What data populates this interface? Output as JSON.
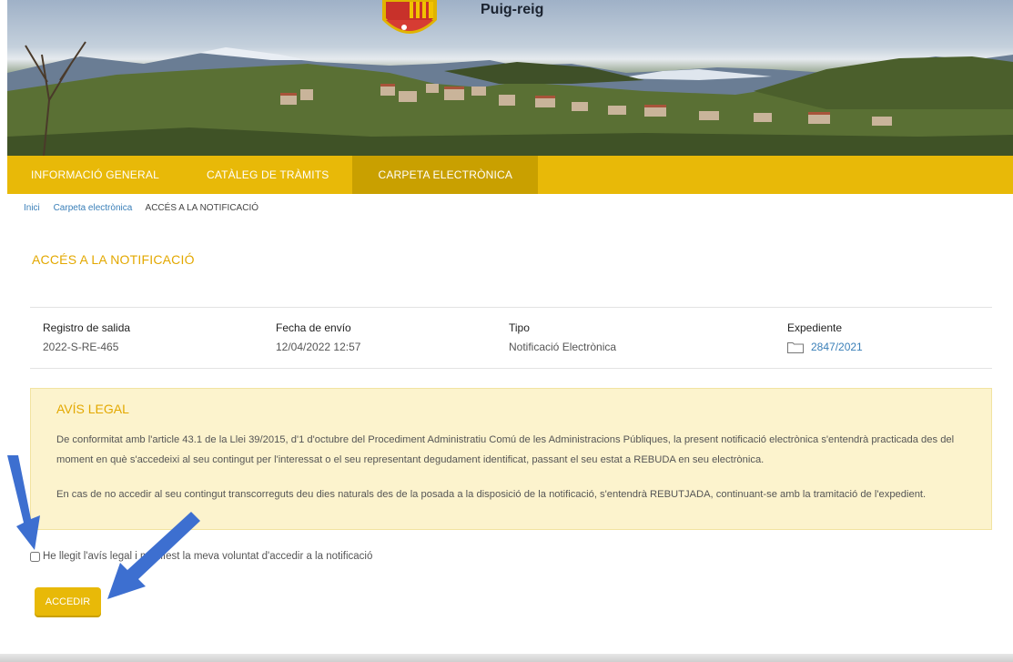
{
  "header": {
    "town_name": "Puig-reig"
  },
  "nav": {
    "items": [
      {
        "label": "INFORMACIÓ GENERAL"
      },
      {
        "label": "CATÀLEG DE TRÀMITS"
      },
      {
        "label": "CARPETA ELECTRÒNICA"
      }
    ],
    "active_index": 2
  },
  "breadcrumb": {
    "items": [
      "Inici",
      "Carpeta electrònica",
      "ACCÉS A LA NOTIFICACIÓ"
    ]
  },
  "page": {
    "title": "ACCÉS A LA NOTIFICACIÓ"
  },
  "details": {
    "registro": {
      "label": "Registro de salida",
      "value": "2022-S-RE-465"
    },
    "fecha": {
      "label": "Fecha de envío",
      "value": "12/04/2022 12:57"
    },
    "tipo": {
      "label": "Tipo",
      "value": "Notificació Electrònica"
    },
    "expediente": {
      "label": "Expediente",
      "value": "2847/2021",
      "icon": "folder-icon"
    }
  },
  "legal": {
    "title": "AVÍS LEGAL",
    "paragraph1": "De conformitat amb l'article 43.1 de la Llei 39/2015, d'1 d'octubre del Procediment Administratiu Comú de les Administracions Públiques, la present notificació electrònica s'entendrà practicada des del moment en què s'accedeixi al seu contingut per l'interessat o el seu representant degudament identificat, passant el seu estat a REBUDA en seu electrònica.",
    "paragraph2": "En cas de no accedir al seu contingut transcorreguts deu dies naturals des de la posada a la disposició de la notificació, s'entendrà REBUTJADA, continuant-se amb la tramitació de l'expedient."
  },
  "consent": {
    "label": "He llegit l'avís legal i manifest la meva voluntat d'accedir a la notificació",
    "checked": false
  },
  "actions": {
    "access_label": "ACCEDIR"
  },
  "colors": {
    "accent": "#e8b908",
    "accent_dark": "#c9a000",
    "title": "#e3a800",
    "link": "#3a7fb8",
    "legal_bg": "#fcf3cd",
    "arrow": "#3d6fd0"
  }
}
